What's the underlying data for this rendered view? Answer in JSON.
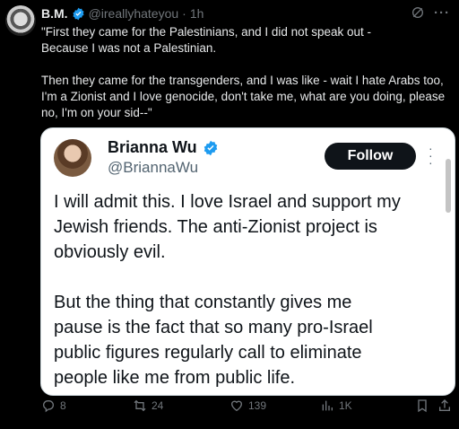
{
  "tweet": {
    "author_name": "B.M.",
    "handle": "@ireallyhateyou",
    "separator": "·",
    "time": "1h",
    "text": "\"First they came for the Palestinians, and I did not speak out -\nBecause I was not a Palestinian.\n\nThen they came for the transgenders, and I was like - wait I hate Arabs too,\nI'm a Zionist and I love genocide, don't take me, what are you doing, please\nno, I'm on your sid--\""
  },
  "quote": {
    "author_name": "Brianna Wu",
    "handle": "@BriannaWu",
    "follow_label": "Follow",
    "text": "I will admit this. I love Israel and support my\nJewish friends. The anti-Zionist project is\nobviously evil.\n\nBut the thing that constantly gives me\npause is the fact that so many pro-Israel\npublic figures regularly call to eliminate\npeople like me from public life."
  },
  "actions": {
    "replies": "8",
    "retweets": "24",
    "likes": "139",
    "views": "1K"
  },
  "colors": {
    "verified": "#1d9bf0",
    "muted": "#71767b",
    "background": "#000000"
  }
}
